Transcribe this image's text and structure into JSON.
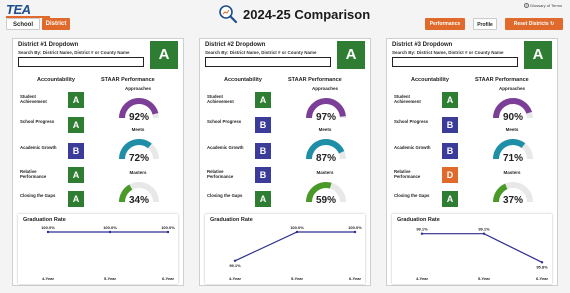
{
  "header": {
    "logo_text": "TEA",
    "logo_subtext": "Texas Education Agency",
    "tab_school": "School",
    "tab_district": "District",
    "title": "2024-25 Comparison",
    "glossary": "Glossary of Terms",
    "btn_performance": "Performance",
    "btn_profile": "Profile",
    "btn_reset": "Reset Districts ↻"
  },
  "colors": {
    "orange": "#e06a2c",
    "green": "#2e7d32",
    "navy": "#3b3b9a",
    "purple": "#7b3f98",
    "teal": "#1f8fa8",
    "lime": "#4a9a2a",
    "line": "#2d2d8f"
  },
  "labels": {
    "search": "Search By: District Name, District # or County Name",
    "accountability": "Accountability",
    "staar": "STAAR Performance",
    "student_achievement": "Student Achievement",
    "school_progress": "School Progress",
    "academic_growth": "Academic Growth",
    "relative_performance": "Relative Performance",
    "closing_gaps": "Closing the Gaps",
    "approaches": "Approaches",
    "meets": "Meets",
    "masters": "Masters",
    "graduation_rate": "Graduation Rate"
  },
  "panels": [
    {
      "title": "District #1 Dropdown",
      "overall": "A",
      "grades": {
        "student_achievement": "A",
        "school_progress": "A",
        "academic_growth": "B",
        "relative_performance": "A",
        "closing_gaps": "A"
      },
      "staar": {
        "approaches": "92%",
        "meets": "72%",
        "masters": "34%",
        "approaches_pct": 92,
        "meets_pct": 72,
        "masters_pct": 34
      },
      "chart_data": {
        "type": "line",
        "title": "Graduation Rate",
        "categories": [
          "4-Year",
          "5-Year",
          "6-Year"
        ],
        "values": [
          100.0,
          100.0,
          100.0
        ],
        "labels": [
          "100.0%",
          "100.0%",
          "100.0%"
        ],
        "ylim": [
          99.0,
          100.0
        ]
      }
    },
    {
      "title": "District #2 Dropdown",
      "overall": "A",
      "grades": {
        "student_achievement": "A",
        "school_progress": "B",
        "academic_growth": "B",
        "relative_performance": "B",
        "closing_gaps": "A"
      },
      "staar": {
        "approaches": "97%",
        "meets": "87%",
        "masters": "59%",
        "approaches_pct": 97,
        "meets_pct": 87,
        "masters_pct": 59
      },
      "chart_data": {
        "type": "line",
        "title": "Graduation Rate",
        "categories": [
          "4-Year",
          "5-Year",
          "6-Year"
        ],
        "values": [
          99.1,
          100.0,
          100.0
        ],
        "labels": [
          "99.1%",
          "100.0%",
          "100.0%"
        ],
        "ylim": [
          99.0,
          100.0
        ]
      }
    },
    {
      "title": "District #3 Dropdown",
      "overall": "A",
      "grades": {
        "student_achievement": "A",
        "school_progress": "B",
        "academic_growth": "B",
        "relative_performance": "D",
        "closing_gaps": "A"
      },
      "staar": {
        "approaches": "90%",
        "meets": "71%",
        "masters": "37%",
        "approaches_pct": 90,
        "meets_pct": 71,
        "masters_pct": 37
      },
      "chart_data": {
        "type": "line",
        "title": "Graduation Rate",
        "categories": [
          "4-Year",
          "5-Year",
          "6-Year"
        ],
        "values": [
          99.1,
          99.1,
          95.8
        ],
        "labels": [
          "99.1%",
          "99.1%",
          "95.8%"
        ],
        "ylim": [
          95.6,
          99.3
        ]
      }
    }
  ]
}
